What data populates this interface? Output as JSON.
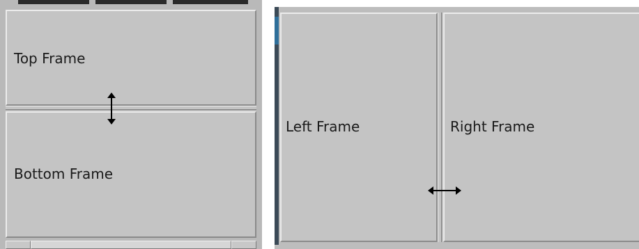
{
  "left_window": {
    "top_frame_label": "Top Frame",
    "bottom_frame_label": "Bottom Frame",
    "resize_cursor_icon": "vertical-resize-arrow-icon"
  },
  "right_window": {
    "left_frame_label": "Left Frame",
    "right_frame_label": "Right Frame",
    "resize_cursor_icon": "horizontal-resize-arrow-icon"
  }
}
